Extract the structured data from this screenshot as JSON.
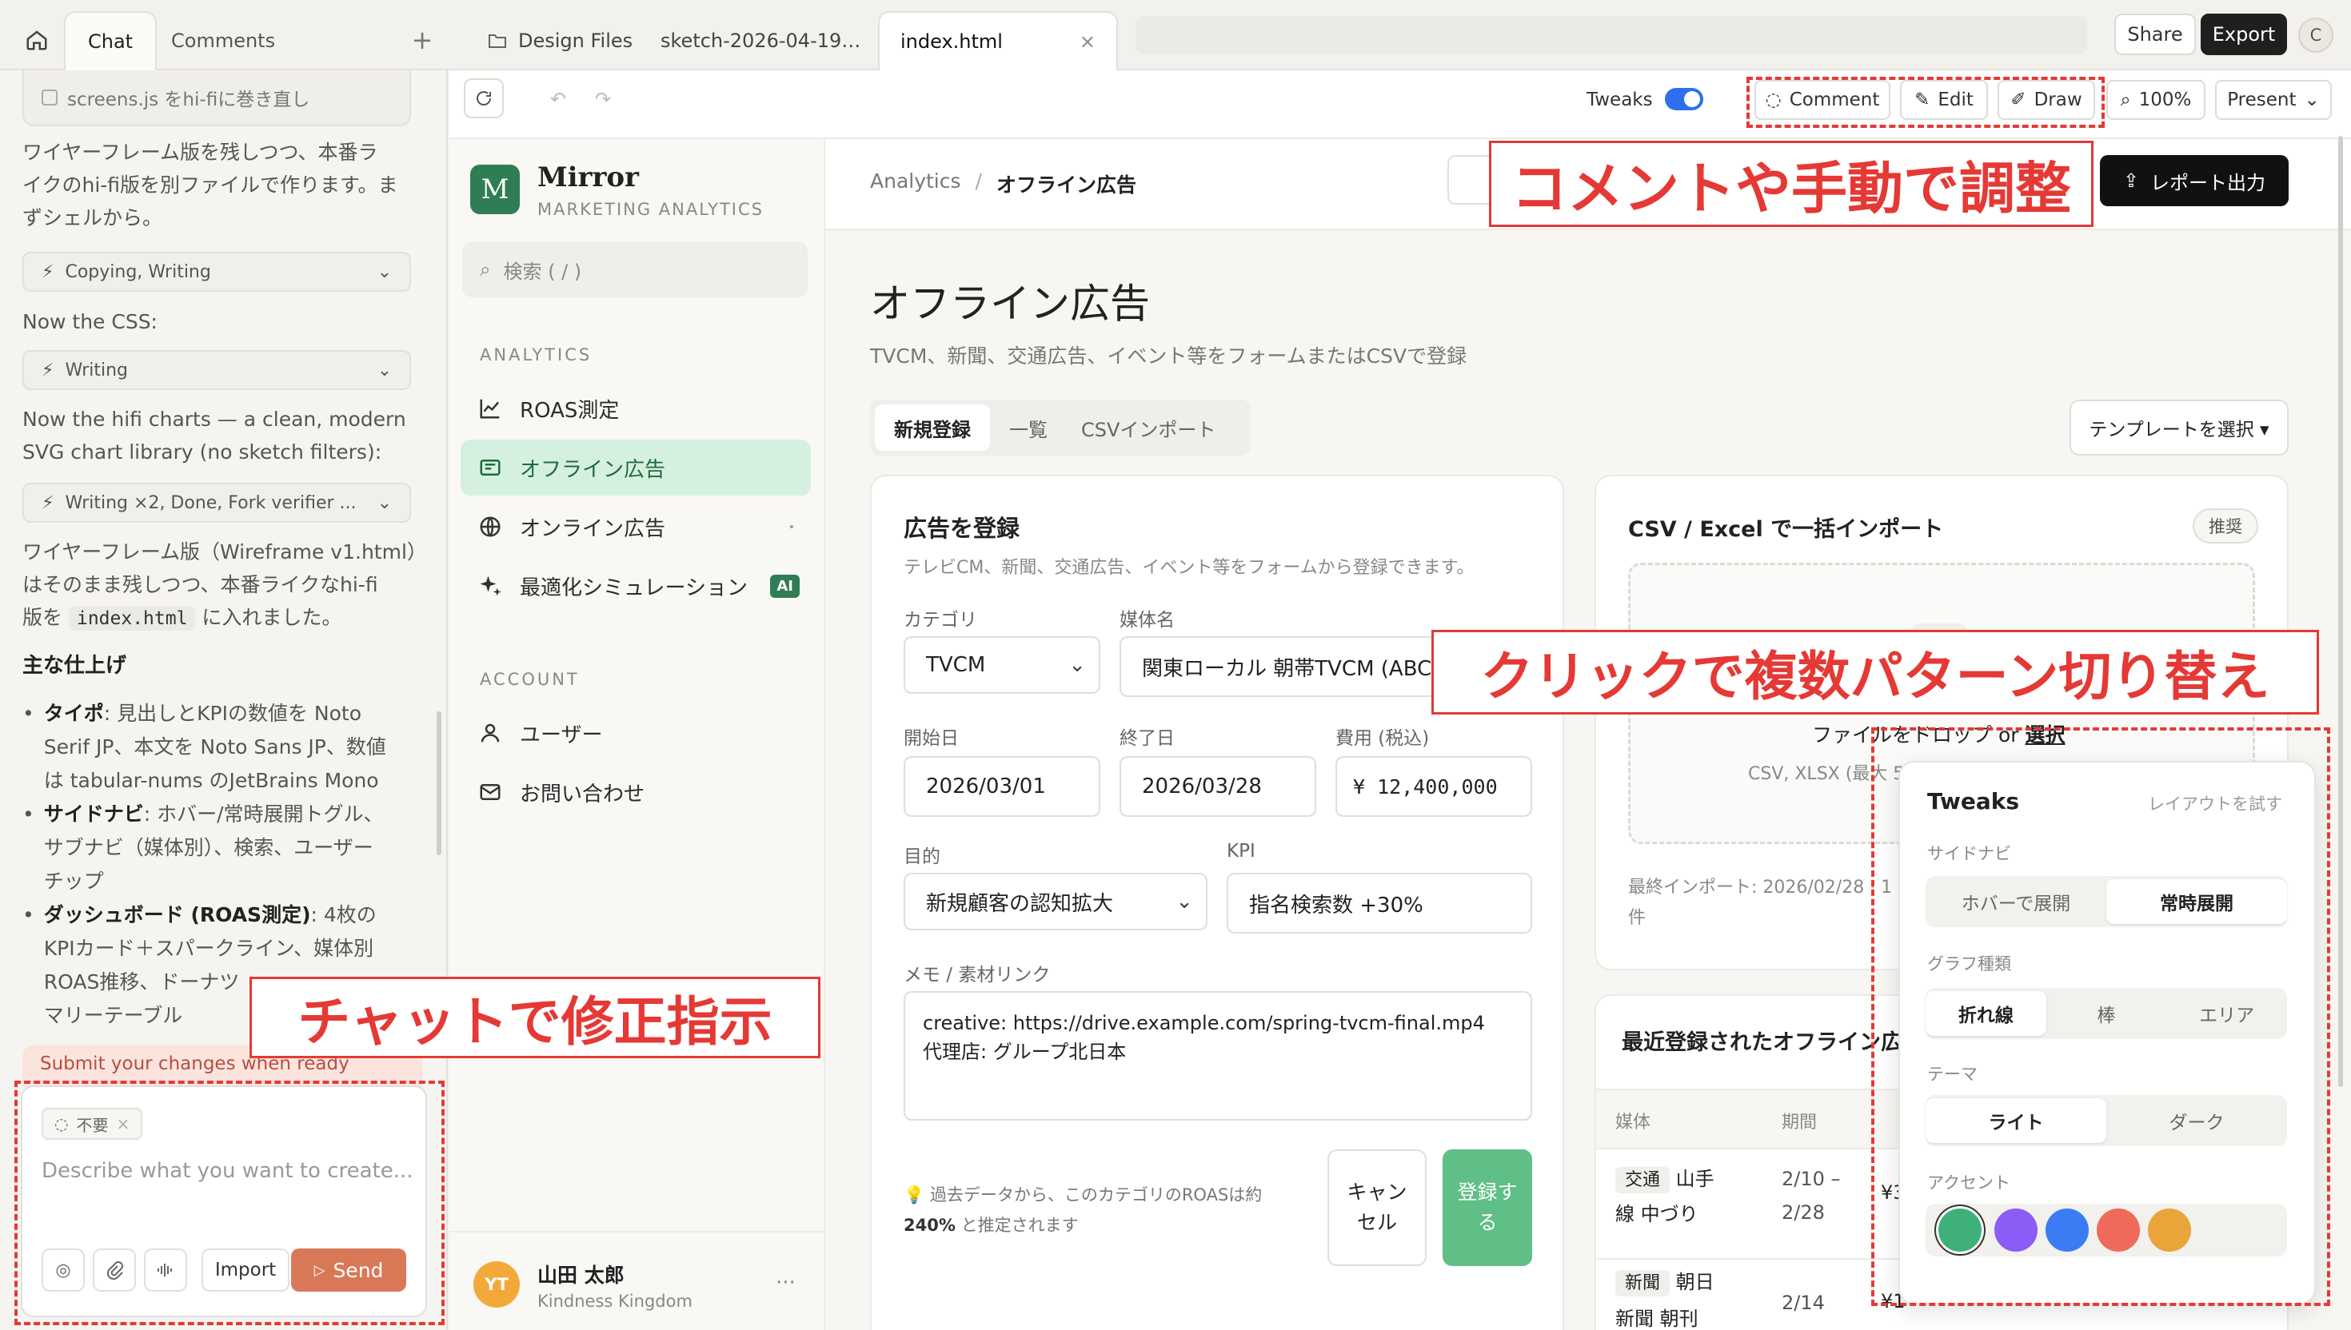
{
  "topbar": {
    "left_tabs": [
      "Chat",
      "Comments"
    ],
    "file_tabs": [
      "Design Files",
      "sketch-2026-04-19…",
      "index.html"
    ],
    "share": "Share",
    "export": "Export",
    "avatar": "C"
  },
  "chat": {
    "task_item": "screens.js をhi-fiに巻き直し",
    "para1": [
      "ワイヤーフレーム版を残しつつ、本番ラ",
      "イクのhi-fi版を別ファイルで作ります。ま",
      "ずシェルから。"
    ],
    "tool1": "Copying, Writing",
    "para2": "Now the CSS:",
    "tool2": "Writing",
    "para3": [
      "Now the hifi charts — a clean, modern",
      "SVG chart library (no sketch filters):"
    ],
    "tool3": "Writing ×2, Done, Fork verifier ...",
    "para4": [
      "ワイヤーフレーム版（Wireframe v1.html）",
      "はそのまま残しつつ、本番ライクなhi-fi"
    ],
    "para4_pre": "版を",
    "para4_code": "index.html",
    "para4_post": "に入れました。",
    "heading": "主な仕上げ",
    "b1_bold": "タイポ",
    "b1": [
      ": 見出しとKPIの数値を Noto",
      "Serif JP、本文を Noto Sans JP、数値",
      "は tabular-nums のJetBrains Mono"
    ],
    "b2_bold": "サイドナビ",
    "b2": [
      ": ホバー/常時展開トグル、",
      "サブナビ（媒体別）、検索、ユーザー",
      "チップ"
    ],
    "b3_bold": "ダッシュボード (ROAS測定)",
    "b3": [
      ": 4枚の",
      "KPIカード＋スパークライン、媒体別",
      "ROAS推移、ドーナツ",
      "マリーテーブル"
    ],
    "submit_banner": "Submit your changes when ready",
    "chip": "不要",
    "placeholder": "Describe what you want to create...",
    "import": "Import",
    "send": "Send"
  },
  "toolbar": {
    "tweaks_label": "Tweaks",
    "tweaks_on": true,
    "comment": "Comment",
    "edit": "Edit",
    "draw": "Draw",
    "zoom": "100%",
    "present": "Present"
  },
  "app": {
    "brand_letter": "M",
    "brand": "Mirror",
    "brand_sub": "MARKETING ANALYTICS",
    "search": "検索 ( / )",
    "sec_analytics": "ANALYTICS",
    "nav": [
      {
        "label": "ROAS測定",
        "icon": "chart-line-icon"
      },
      {
        "label": "オフライン広告",
        "icon": "newspaper-icon"
      },
      {
        "label": "オンライン広告",
        "icon": "globe-icon"
      },
      {
        "label": "最適化シミュレーション",
        "icon": "sparkle-icon",
        "badge": "AI"
      }
    ],
    "sec_account": "ACCOUNT",
    "account": [
      {
        "label": "ユーザー",
        "icon": "user-icon"
      },
      {
        "label": "お問い合わせ",
        "icon": "mail-icon"
      }
    ],
    "user_initials": "YT",
    "user_name": "山田 太郎",
    "user_org": "Kindness Kingdom",
    "user_more": "···"
  },
  "page": {
    "breadcrumb_root": "Analytics",
    "breadcrumb_sep": "/",
    "breadcrumb_current": "オフライン広告",
    "report_btn": "レポート出力",
    "title": "オフライン広告",
    "subtitle": "TVCM、新聞、交通広告、イベント等をフォームまたはCSVで登録",
    "tabs": [
      "新規登録",
      "一覧",
      "CSVインポート"
    ],
    "template_btn": "テンプレートを選択 ▾",
    "form": {
      "title": "広告を登録",
      "desc": "テレビCM、新聞、交通広告、イベント等をフォームから登録できます。",
      "category_label": "カテゴリ",
      "category_value": "TVCM",
      "media_label": "媒体名",
      "media_value": "関東ローカル 朝帯TVCM (ABCテ",
      "start_label": "開始日",
      "start_value": "2026/03/01",
      "end_label": "終了日",
      "end_value": "2026/03/28",
      "cost_label": "費用 (税込)",
      "cost_value": "¥ 12,400,000",
      "purpose_label": "目的",
      "purpose_value": "新規顧客の認知拡大",
      "kpi_label": "KPI",
      "kpi_value": "指名検索数 +30%",
      "memo_label": "メモ / 素材リンク",
      "memo_line1": "creative: https://drive.example.com/spring-tvcm-final.mp4",
      "memo_line2": "代理店: グループ北日本",
      "hint_line1": "💡 過去データから、このカテゴリのROASは約",
      "hint_bold": "240%",
      "hint_line2": " と推定されます",
      "cancel": "キャンセル",
      "submit": "登録する"
    },
    "csv": {
      "title": "CSV / Excel で一括インポート",
      "badge": "推奨",
      "drop_text": "ファイルをドロップ or ",
      "drop_link": "選択",
      "drop_sub": "CSV, XLSX (最大 5",
      "last_import": "最終インポート: 2026/02/28 · 1",
      "last_import2": "件"
    },
    "recent": {
      "title": "最近登録されたオフライン広",
      "col_media": "媒体",
      "col_period": "期間",
      "rows": [
        {
          "tag": "交通",
          "name1": "山手",
          "name2": "線 中づり",
          "period1": "2/10 –",
          "period2": "2/28",
          "cost": "¥3"
        },
        {
          "tag": "新聞",
          "name1": "朝日",
          "name2": "新聞 朝刊",
          "period1": "2/14",
          "period2": "",
          "cost": "¥1"
        }
      ]
    },
    "tweaks": {
      "title": "Tweaks",
      "hint": "レイアウトを試す",
      "sidenav_label": "サイドナビ",
      "sidenav_opts": [
        "ホバーで展開",
        "常時展開"
      ],
      "graph_label": "グラフ種類",
      "graph_opts": [
        "折れ線",
        "棒",
        "エリア"
      ],
      "theme_label": "テーマ",
      "theme_opts": [
        "ライト",
        "ダーク"
      ],
      "accent_label": "アクセント",
      "accents": [
        "#3fb07a",
        "#8b5cf6",
        "#3b7cf5",
        "#ef6a5a",
        "#e9a43a"
      ]
    }
  },
  "annotations": {
    "chat_label": "チャットで修正指示",
    "comment_label": "コメントや手動で調整",
    "click_label": "クリックで複数パターン切り替え"
  }
}
